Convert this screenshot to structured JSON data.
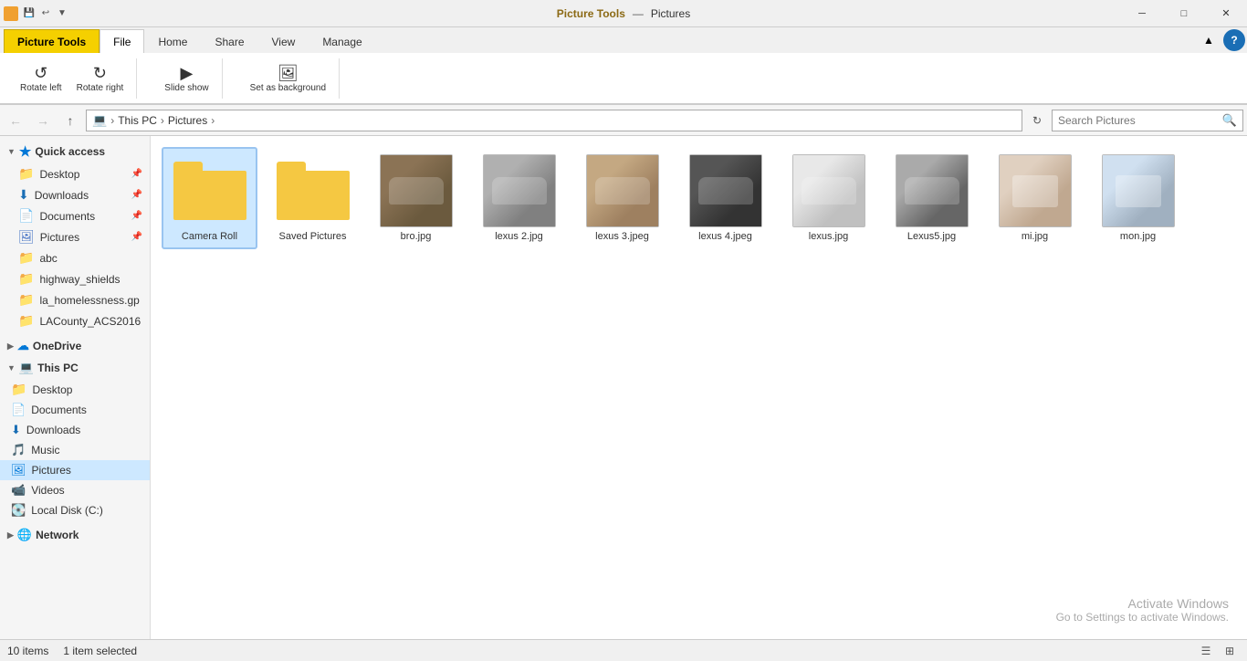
{
  "titlebar": {
    "app_name": "Pictures",
    "picture_tools_label": "Picture Tools",
    "min_btn": "─",
    "max_btn": "□",
    "close_btn": "✕"
  },
  "ribbon": {
    "tabs": [
      {
        "id": "file",
        "label": "File"
      },
      {
        "id": "home",
        "label": "Home"
      },
      {
        "id": "share",
        "label": "Share"
      },
      {
        "id": "view",
        "label": "View"
      },
      {
        "id": "manage",
        "label": "Manage"
      }
    ],
    "picture_tools_tab": "Picture Tools"
  },
  "address_bar": {
    "back_tooltip": "Back",
    "forward_tooltip": "Forward",
    "up_tooltip": "Up",
    "path": [
      "This PC",
      "Pictures"
    ],
    "search_placeholder": "Search Pictures",
    "refresh_tooltip": "Refresh"
  },
  "sidebar": {
    "quick_access_label": "Quick access",
    "items_quick": [
      {
        "id": "desktop",
        "label": "Desktop",
        "pinned": true
      },
      {
        "id": "downloads_qa",
        "label": "Downloads",
        "pinned": true
      },
      {
        "id": "documents",
        "label": "Documents",
        "pinned": true
      },
      {
        "id": "pictures",
        "label": "Pictures",
        "pinned": true
      }
    ],
    "folders_quick": [
      {
        "id": "abc",
        "label": "abc"
      },
      {
        "id": "highway_shields",
        "label": "highway_shields"
      },
      {
        "id": "la_homelessness",
        "label": "la_homelessness.gp"
      },
      {
        "id": "lacounty",
        "label": "LACounty_ACS2016"
      }
    ],
    "onedrive_label": "OneDrive",
    "thispc_label": "This PC",
    "thispc_items": [
      {
        "id": "desktop_pc",
        "label": "Desktop"
      },
      {
        "id": "documents_pc",
        "label": "Documents"
      },
      {
        "id": "downloads_pc",
        "label": "Downloads"
      },
      {
        "id": "music_pc",
        "label": "Music"
      },
      {
        "id": "pictures_pc",
        "label": "Pictures",
        "active": true
      },
      {
        "id": "videos_pc",
        "label": "Videos"
      },
      {
        "id": "local_disk",
        "label": "Local Disk (C:)"
      }
    ],
    "network_label": "Network"
  },
  "content": {
    "items": [
      {
        "id": "camera_roll",
        "label": "Camera Roll",
        "type": "folder",
        "selected": true
      },
      {
        "id": "saved_pictures",
        "label": "Saved Pictures",
        "type": "folder",
        "selected": false
      },
      {
        "id": "bro_jpg",
        "label": "bro.jpg",
        "type": "image",
        "thumb_class": "thumb-bro"
      },
      {
        "id": "lexus2_jpg",
        "label": "lexus 2.jpg",
        "type": "image",
        "thumb_class": "thumb-lexus2"
      },
      {
        "id": "lexus3_jpeg",
        "label": "lexus 3.jpeg",
        "type": "image",
        "thumb_class": "thumb-lexus3"
      },
      {
        "id": "lexus4_jpeg",
        "label": "lexus 4.jpeg",
        "type": "image",
        "thumb_class": "thumb-lexus4"
      },
      {
        "id": "lexus_jpg",
        "label": "lexus.jpg",
        "type": "image",
        "thumb_class": "thumb-lexus"
      },
      {
        "id": "lexus5_jpg",
        "label": "Lexus5.jpg",
        "type": "image",
        "thumb_class": "thumb-lexus5"
      },
      {
        "id": "mi_jpg",
        "label": "mi.jpg",
        "type": "image",
        "thumb_class": "thumb-mi"
      },
      {
        "id": "mon_jpg",
        "label": "mon.jpg",
        "type": "image",
        "thumb_class": "thumb-mon"
      }
    ]
  },
  "statusbar": {
    "item_count": "10 items",
    "selected_info": "1 item selected"
  },
  "watermark": {
    "line1": "Activate Windows",
    "line2": "Go to Settings to activate Windows."
  }
}
